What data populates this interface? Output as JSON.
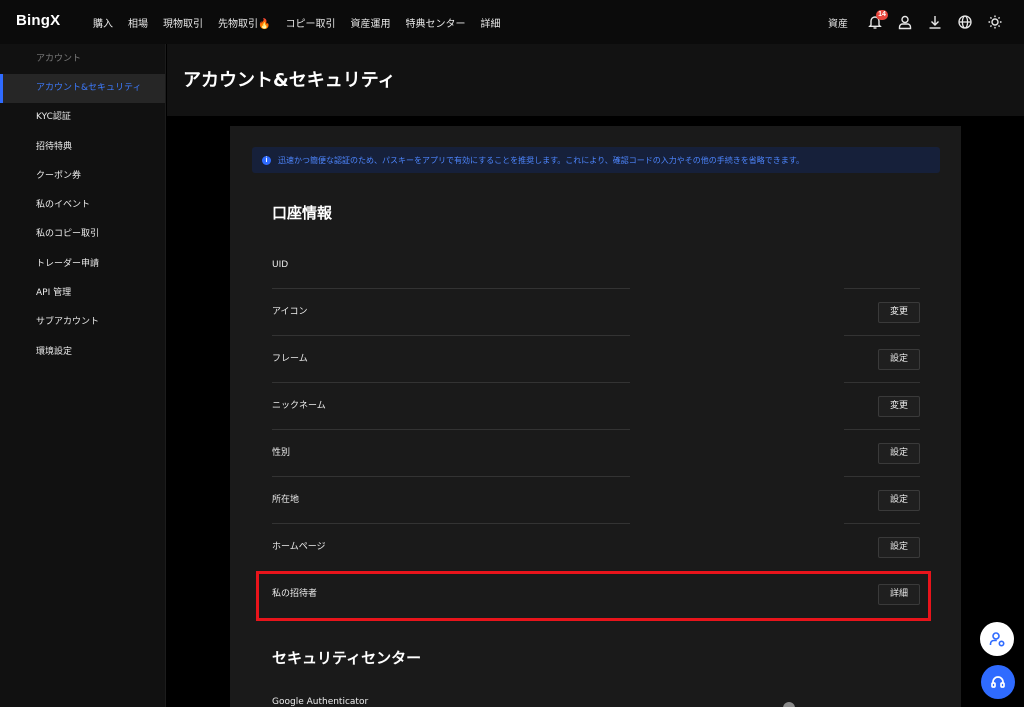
{
  "brand": {
    "logo": "BingX",
    "accent": "#2f6bff",
    "highlight": "#e8141b"
  },
  "nav": {
    "items": [
      "購入",
      "相場",
      "現物取引",
      "先物取引🔥",
      "コピー取引",
      "資産運用",
      "特典センター",
      "詳細"
    ],
    "assets": "資産",
    "notification_count": "14",
    "icons": [
      "bell-icon",
      "user-icon",
      "download-icon",
      "globe-icon",
      "sun-icon"
    ]
  },
  "sidebar": {
    "header": "アカウント",
    "items": [
      {
        "label": "アカウント&セキュリティ",
        "active": true
      },
      {
        "label": "KYC認証"
      },
      {
        "label": "招待特典"
      },
      {
        "label": "クーポン券"
      },
      {
        "label": "私のイベント"
      },
      {
        "label": "私のコピー取引"
      },
      {
        "label": "トレーダー申請"
      },
      {
        "label": "API 管理"
      },
      {
        "label": "サブアカウント"
      },
      {
        "label": "環境設定"
      }
    ]
  },
  "page": {
    "title": "アカウント&セキュリティ"
  },
  "notice": {
    "text": "迅速かつ簡便な認証のため、パスキーをアプリで有効にすることを推奨します。これにより、確認コードの入力やその他の手続きを省略できます。"
  },
  "account_info": {
    "title": "口座情報",
    "rows": [
      {
        "label": "UID",
        "button": ""
      },
      {
        "label": "アイコン",
        "button": "変更"
      },
      {
        "label": "フレーム",
        "button": "設定"
      },
      {
        "label": "ニックネーム",
        "button": "変更"
      },
      {
        "label": "性別",
        "button": "設定"
      },
      {
        "label": "所在地",
        "button": "設定"
      },
      {
        "label": "ホームページ",
        "button": "設定"
      },
      {
        "label": "私の招待者",
        "button": "詳細"
      }
    ]
  },
  "security_center": {
    "title": "セキュリティセンター",
    "first_row": "Google Authenticator"
  }
}
